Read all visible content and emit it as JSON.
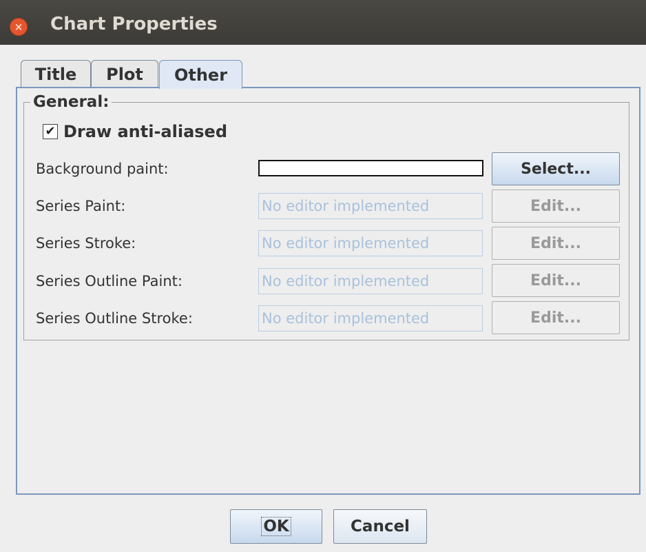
{
  "window": {
    "title": "Chart Properties",
    "close_icon": "×"
  },
  "tabs": [
    {
      "label": "Title",
      "active": false
    },
    {
      "label": "Plot",
      "active": false
    },
    {
      "label": "Other",
      "active": true
    }
  ],
  "general": {
    "group_title": "General:",
    "antialias": {
      "label": "Draw anti-aliased",
      "checked": true,
      "check_glyph": "✔"
    },
    "background_paint": {
      "label": "Background paint:",
      "color": "#ffffff",
      "button": "Select..."
    },
    "rows": [
      {
        "label": "Series Paint:",
        "value": "No editor implemented",
        "button": "Edit..."
      },
      {
        "label": "Series Stroke:",
        "value": "No editor implemented",
        "button": "Edit..."
      },
      {
        "label": "Series Outline Paint:",
        "value": "No editor implemented",
        "button": "Edit..."
      },
      {
        "label": "Series Outline Stroke:",
        "value": "No editor implemented",
        "button": "Edit..."
      }
    ]
  },
  "footer": {
    "ok": "OK",
    "cancel": "Cancel"
  }
}
